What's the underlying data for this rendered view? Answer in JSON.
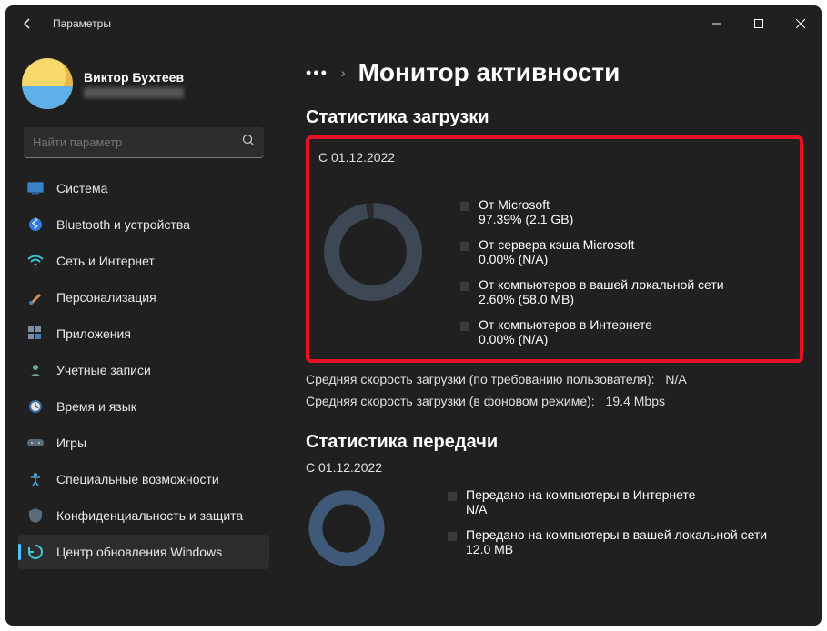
{
  "window": {
    "title": "Параметры"
  },
  "profile": {
    "name": "Виктор Бухтеев"
  },
  "search": {
    "placeholder": "Найти параметр"
  },
  "sidebar": {
    "items": [
      {
        "label": "Система"
      },
      {
        "label": "Bluetooth и устройства"
      },
      {
        "label": "Сеть и Интернет"
      },
      {
        "label": "Персонализация"
      },
      {
        "label": "Приложения"
      },
      {
        "label": "Учетные записи"
      },
      {
        "label": "Время и язык"
      },
      {
        "label": "Игры"
      },
      {
        "label": "Специальные возможности"
      },
      {
        "label": "Конфиденциальность и защита"
      },
      {
        "label": "Центр обновления Windows"
      }
    ]
  },
  "breadcrumb": {
    "dots": "•••",
    "title": "Монитор активности"
  },
  "download": {
    "section_title": "Статистика загрузки",
    "since": "С 01.12.2022",
    "items": [
      {
        "label": "От Microsoft",
        "value": "97.39%  (2.1 GB)"
      },
      {
        "label": "От сервера кэша Microsoft",
        "value": "0.00%  (N/A)"
      },
      {
        "label": "От компьютеров в вашей локальной сети",
        "value": "2.60%  (58.0 MB)"
      },
      {
        "label": "От компьютеров в Интернете",
        "value": "0.00%  (N/A)"
      }
    ],
    "avg_demand": {
      "label": "Средняя скорость загрузки (по требованию пользователя):",
      "value": "N/A"
    },
    "avg_bg": {
      "label": "Средняя скорость загрузки (в фоновом режиме):",
      "value": "19.4 Mbps"
    }
  },
  "upload": {
    "section_title": "Статистика передачи",
    "since": "С 01.12.2022",
    "items": [
      {
        "label": "Передано на компьютеры в Интернете",
        "value": "N/A"
      },
      {
        "label": "Передано на компьютеры в вашей локальной сети",
        "value": "12.0 MB"
      }
    ]
  },
  "chart_data": [
    {
      "type": "pie",
      "title": "Статистика загрузки",
      "categories": [
        "От Microsoft",
        "От сервера кэша Microsoft",
        "От компьютеров в вашей локальной сети",
        "От компьютеров в Интернете"
      ],
      "values": [
        97.39,
        0.0,
        2.6,
        0.0
      ],
      "sizes": [
        "2.1 GB",
        "N/A",
        "58.0 MB",
        "N/A"
      ]
    },
    {
      "type": "pie",
      "title": "Статистика передачи",
      "categories": [
        "Передано на компьютеры в Интернете",
        "Передано на компьютеры в вашей локальной сети"
      ],
      "values": [
        null,
        null
      ],
      "sizes": [
        "N/A",
        "12.0 MB"
      ]
    }
  ]
}
